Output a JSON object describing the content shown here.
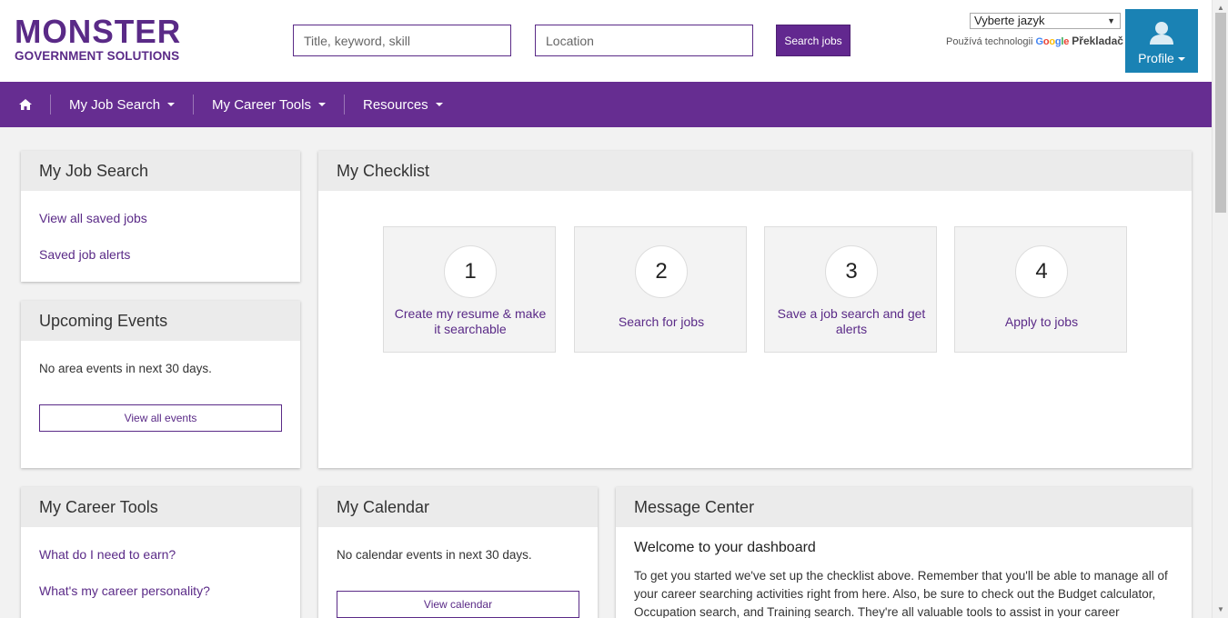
{
  "header": {
    "logo_main": "MONSTER",
    "logo_sub": "GOVERNMENT SOLUTIONS",
    "keyword_placeholder": "Title, keyword, skill",
    "location_placeholder": "Location",
    "search_label": "Search jobs",
    "language_select": "Vyberte jazyk",
    "powered_prefix": "Používá technologii",
    "google_word": [
      "G",
      "o",
      "o",
      "g",
      "l",
      "e"
    ],
    "translate_word": "Překladač",
    "profile_label": "Profile",
    "profile_icon": "user-icon"
  },
  "nav": {
    "home_icon": "home-icon",
    "items": [
      {
        "label": "My Job Search"
      },
      {
        "label": "My Career Tools"
      },
      {
        "label": "Resources"
      }
    ]
  },
  "job_search": {
    "title": "My Job Search",
    "links": [
      "View all saved jobs",
      "Saved job alerts"
    ]
  },
  "events": {
    "title": "Upcoming Events",
    "empty_text": "No area events in next 30 days.",
    "button": "View all events"
  },
  "checklist": {
    "title": "My Checklist",
    "steps": [
      {
        "number": "1",
        "label": "Create my resume & make it searchable"
      },
      {
        "number": "2",
        "label": "Search for jobs"
      },
      {
        "number": "3",
        "label": "Save a job search and get alerts"
      },
      {
        "number": "4",
        "label": "Apply to jobs"
      }
    ]
  },
  "career_tools": {
    "title": "My Career Tools",
    "links": [
      "What do I need to earn?",
      "What's my career personality?"
    ]
  },
  "calendar": {
    "title": "My Calendar",
    "empty_text": "No calendar events in next 30 days.",
    "button": "View calendar"
  },
  "messages": {
    "title": "Message Center",
    "welcome": "Welcome to your dashboard",
    "body": "To get you started we've set up the checklist above. Remember that you'll be able to manage all of your career searching activities right from here. Also, be sure to check out the Budget calculator, Occupation search, and Training search. They're all valuable tools to assist in your career evolution."
  },
  "colors": {
    "brand_purple": "#662d91",
    "profile_blue": "#1a82b4"
  }
}
